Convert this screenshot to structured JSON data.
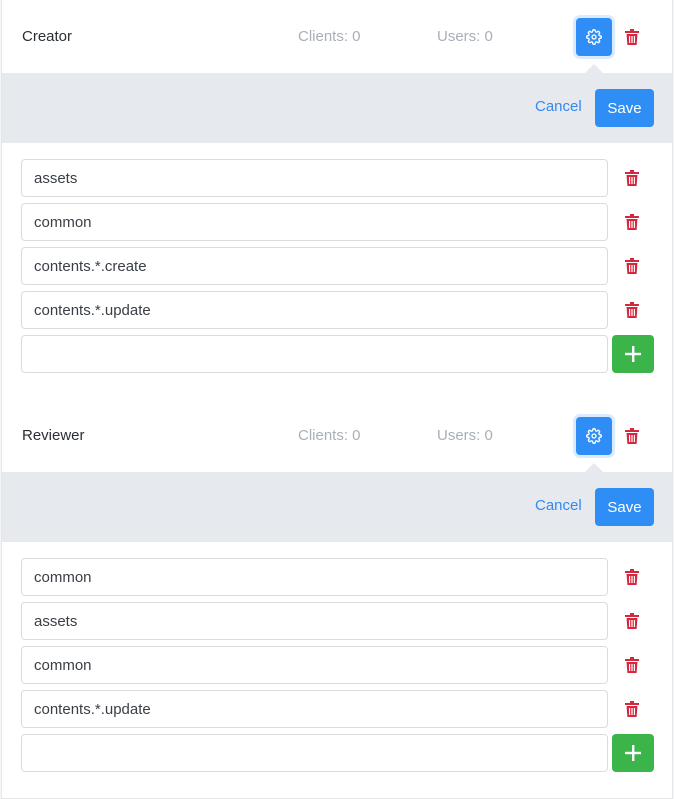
{
  "roles": [
    {
      "name": "Creator",
      "clients": "Clients: 0",
      "users": "Users: 0",
      "cancel_label": "Cancel",
      "save_label": "Save",
      "permissions": [
        "assets",
        "common",
        "contents.*.create",
        "contents.*.update"
      ],
      "new_permission_value": ""
    },
    {
      "name": "Reviewer",
      "clients": "Clients: 0",
      "users": "Users: 0",
      "cancel_label": "Cancel",
      "save_label": "Save",
      "permissions": [
        "common",
        "assets",
        "common",
        "contents.*.update"
      ],
      "new_permission_value": ""
    }
  ],
  "colors": {
    "primary": "#2f8ef5",
    "danger": "#d4283f",
    "success": "#3bb54a",
    "muted": "#a8afb8"
  },
  "icons": {
    "settings": "gear-icon",
    "delete": "trash-icon",
    "add": "plus-icon"
  }
}
